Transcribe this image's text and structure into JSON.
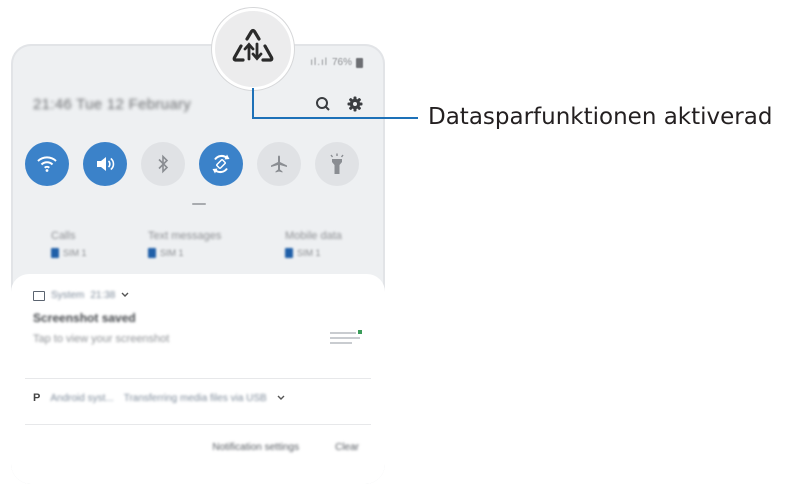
{
  "callout": {
    "label": "Datasparfunktionen aktiverad",
    "icon": "data-saver-icon"
  },
  "status_bar": {
    "signal": "ıl.ıl",
    "battery_text": "76%"
  },
  "header": {
    "datetime": "21:46  Tue 12 February"
  },
  "quick_toggles": [
    {
      "name": "wifi",
      "icon": "wifi-icon",
      "state": "on"
    },
    {
      "name": "sound",
      "icon": "sound-icon",
      "state": "on"
    },
    {
      "name": "bluetooth",
      "icon": "bluetooth-icon",
      "state": "off"
    },
    {
      "name": "auto-rotate",
      "icon": "auto-rotate-icon",
      "state": "on"
    },
    {
      "name": "airplane-mode",
      "icon": "airplane-icon",
      "state": "off"
    },
    {
      "name": "flashlight",
      "icon": "flashlight-icon",
      "state": "off"
    }
  ],
  "usage": [
    {
      "title": "Calls",
      "sim": "SIM 1"
    },
    {
      "title": "Text messages",
      "sim": "SIM 1"
    },
    {
      "title": "Mobile data",
      "sim": "SIM 1"
    }
  ],
  "notifications": [
    {
      "app": "System",
      "time": "21:38",
      "title": "Screenshot saved",
      "text": "Tap to view your screenshot"
    },
    {
      "app": "Android syst...",
      "text": "Transferring media files via USB"
    }
  ],
  "footer": {
    "settings": "Notification settings",
    "clear": "Clear"
  },
  "colors": {
    "toggle_on": "#3b82c9",
    "leader_line": "#1d71b8"
  }
}
